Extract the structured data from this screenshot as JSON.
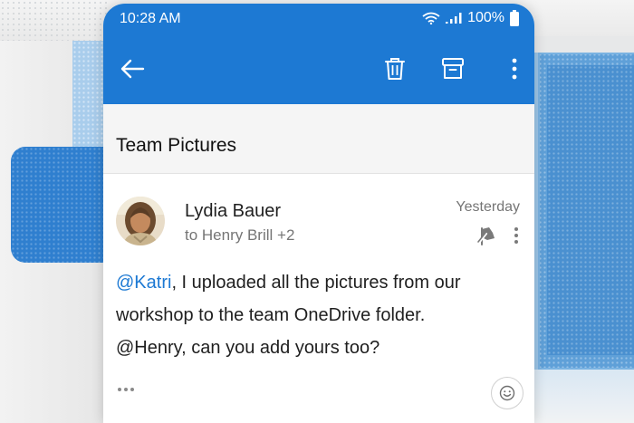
{
  "status_bar": {
    "time": "10:28 AM",
    "battery": "100%"
  },
  "toolbar": {
    "back_icon": "arrow-left-icon",
    "delete_icon": "trash-icon",
    "archive_icon": "archive-icon",
    "more_icon": "more-vertical-icon"
  },
  "message": {
    "subject": "Team Pictures",
    "sender": "Lydia Bauer",
    "recipients": "to Henry Brill +2",
    "date": "Yesterday",
    "body": {
      "mention_katri": "@Katri",
      "line1_rest": ", I uploaded all the pictures from our",
      "line2": "workshop to the team OneDrive folder.",
      "line3": "@Henry, can you add yours too?"
    }
  },
  "colors": {
    "accent": "#1d79d3",
    "mention": "#1d79d3"
  }
}
